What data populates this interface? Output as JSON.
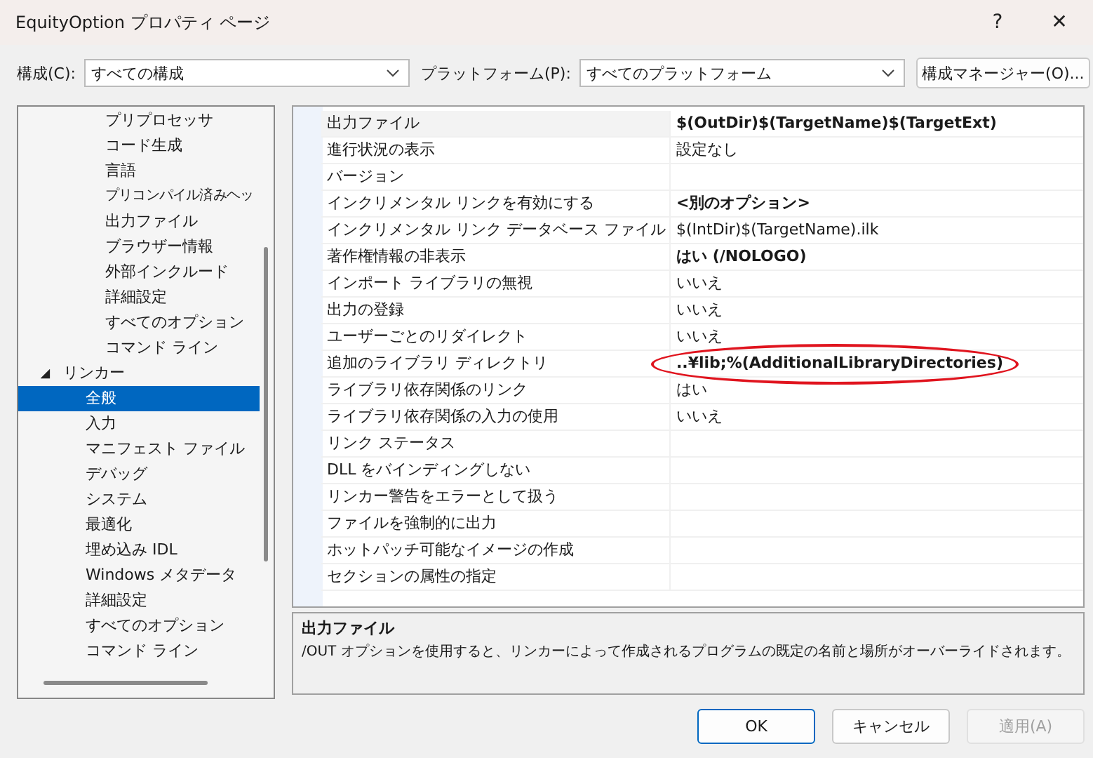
{
  "window": {
    "title": "EquityOption プロパティ ページ",
    "help": "?",
    "close": "✕"
  },
  "toolbar": {
    "configuration_label": "構成(C):",
    "configuration_value": "すべての構成",
    "platform_label": "プラットフォーム(P):",
    "platform_value": "すべてのプラットフォーム",
    "manager_button": "構成マネージャー(O)..."
  },
  "tree": {
    "partial_group_children": [
      {
        "label": "プリプロセッサ",
        "selected": false
      },
      {
        "label": "コード生成",
        "selected": false
      },
      {
        "label": "言語",
        "selected": false
      },
      {
        "label": "プリコンパイル済みヘッ",
        "selected": false
      },
      {
        "label": "出力ファイル",
        "selected": false
      },
      {
        "label": "ブラウザー情報",
        "selected": false
      },
      {
        "label": "外部インクルード",
        "selected": false
      },
      {
        "label": "詳細設定",
        "selected": false
      },
      {
        "label": "すべてのオプション",
        "selected": false
      },
      {
        "label": "コマンド ライン",
        "selected": false
      }
    ],
    "items": [
      {
        "label": "リンカー",
        "expanded": true,
        "selected": false,
        "children": [
          {
            "label": "全般",
            "selected": true
          },
          {
            "label": "入力",
            "selected": false
          },
          {
            "label": "マニフェスト ファイル",
            "selected": false
          },
          {
            "label": "デバッグ",
            "selected": false
          },
          {
            "label": "システム",
            "selected": false
          },
          {
            "label": "最適化",
            "selected": false
          },
          {
            "label": "埋め込み IDL",
            "selected": false
          },
          {
            "label": "Windows メタデータ",
            "selected": false
          },
          {
            "label": "詳細設定",
            "selected": false
          },
          {
            "label": "すべてのオプション",
            "selected": false
          },
          {
            "label": "コマンド ライン",
            "selected": false
          }
        ]
      }
    ]
  },
  "properties": [
    {
      "name": "出力ファイル",
      "value": "$(OutDir)$(TargetName)$(TargetExt)",
      "bold": true,
      "selected": true
    },
    {
      "name": "進行状況の表示",
      "value": "設定なし",
      "bold": false,
      "selected": false
    },
    {
      "name": "バージョン",
      "selected": false
    },
    {
      "name": "インクリメンタル リンクを有効にする",
      "value": "<別のオプション>",
      "bold": true,
      "selected": false
    },
    {
      "name": "インクリメンタル リンク データベース ファイル",
      "value": "$(IntDir)$(TargetName).ilk",
      "bold": false,
      "selected": false
    },
    {
      "name": "著作権情報の非表示",
      "value": "はい (/NOLOGO)",
      "bold": true,
      "selected": false
    },
    {
      "name": "インポート ライブラリの無視",
      "value": "いいえ",
      "bold": false,
      "selected": false
    },
    {
      "name": "出力の登録",
      "value": "いいえ",
      "bold": false,
      "selected": false
    },
    {
      "name": "ユーザーごとのリダイレクト",
      "value": "いいえ",
      "bold": false,
      "selected": false
    },
    {
      "name": "追加のライブラリ ディレクトリ",
      "value": "..¥lib;%(AdditionalLibraryDirectories)",
      "bold": true,
      "selected": false,
      "circled": true
    },
    {
      "name": "ライブラリ依存関係のリンク",
      "value": "はい",
      "bold": false,
      "selected": false
    },
    {
      "name": "ライブラリ依存関係の入力の使用",
      "value": "いいえ",
      "bold": false,
      "selected": false
    },
    {
      "name": "リンク ステータス",
      "selected": false
    },
    {
      "name": "DLL をバインディングしない",
      "selected": false
    },
    {
      "name": "リンカー警告をエラーとして扱う",
      "selected": false
    },
    {
      "name": "ファイルを強制的に出力",
      "selected": false
    },
    {
      "name": "ホットパッチ可能なイメージの作成",
      "selected": false
    },
    {
      "name": "セクションの属性の指定",
      "selected": false
    }
  ],
  "description": {
    "title": "出力ファイル",
    "text": "/OUT オプションを使用すると、リンカーによって作成されるプログラムの既定の名前と場所がオーバーライドされます。"
  },
  "buttons": [
    {
      "label": "OK",
      "kind": "default",
      "disabled": false
    },
    {
      "label": "キャンセル",
      "kind": "normal",
      "disabled": false
    },
    {
      "label": "適用(A)",
      "kind": "normal",
      "disabled": true
    }
  ]
}
